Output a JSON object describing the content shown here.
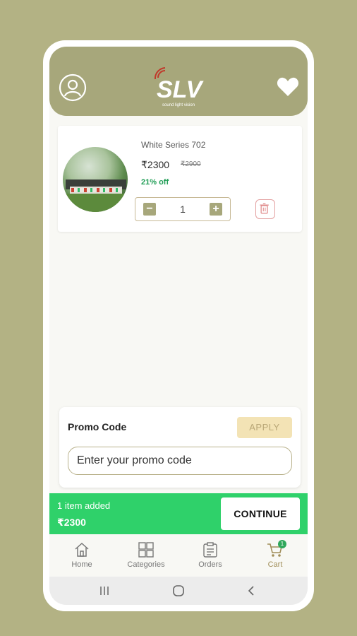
{
  "header": {
    "logo_text": "SLV",
    "logo_tagline": "sound light vision"
  },
  "cart_item": {
    "name": "White Series 702",
    "price": "₹2300",
    "mrp": "₹2900",
    "discount": "21% off",
    "quantity": "1",
    "minus_label": "−",
    "plus_label": "+"
  },
  "promo": {
    "title": "Promo Code",
    "apply_label": "APPLY",
    "placeholder": "Enter your promo code"
  },
  "checkout": {
    "items_added": "1 item added",
    "total": "₹2300",
    "continue_label": "CONTINUE"
  },
  "bottom_nav": {
    "items": [
      {
        "label": "Home",
        "icon": "home-icon"
      },
      {
        "label": "Categories",
        "icon": "grid-icon"
      },
      {
        "label": "Orders",
        "icon": "clipboard-icon"
      },
      {
        "label": "Cart",
        "icon": "cart-icon",
        "badge": "1",
        "active": true
      }
    ]
  },
  "colors": {
    "background": "#b3b284",
    "appbar": "#a7a77b",
    "accent_green": "#2fd16a",
    "discount_green": "#1f9d55"
  }
}
